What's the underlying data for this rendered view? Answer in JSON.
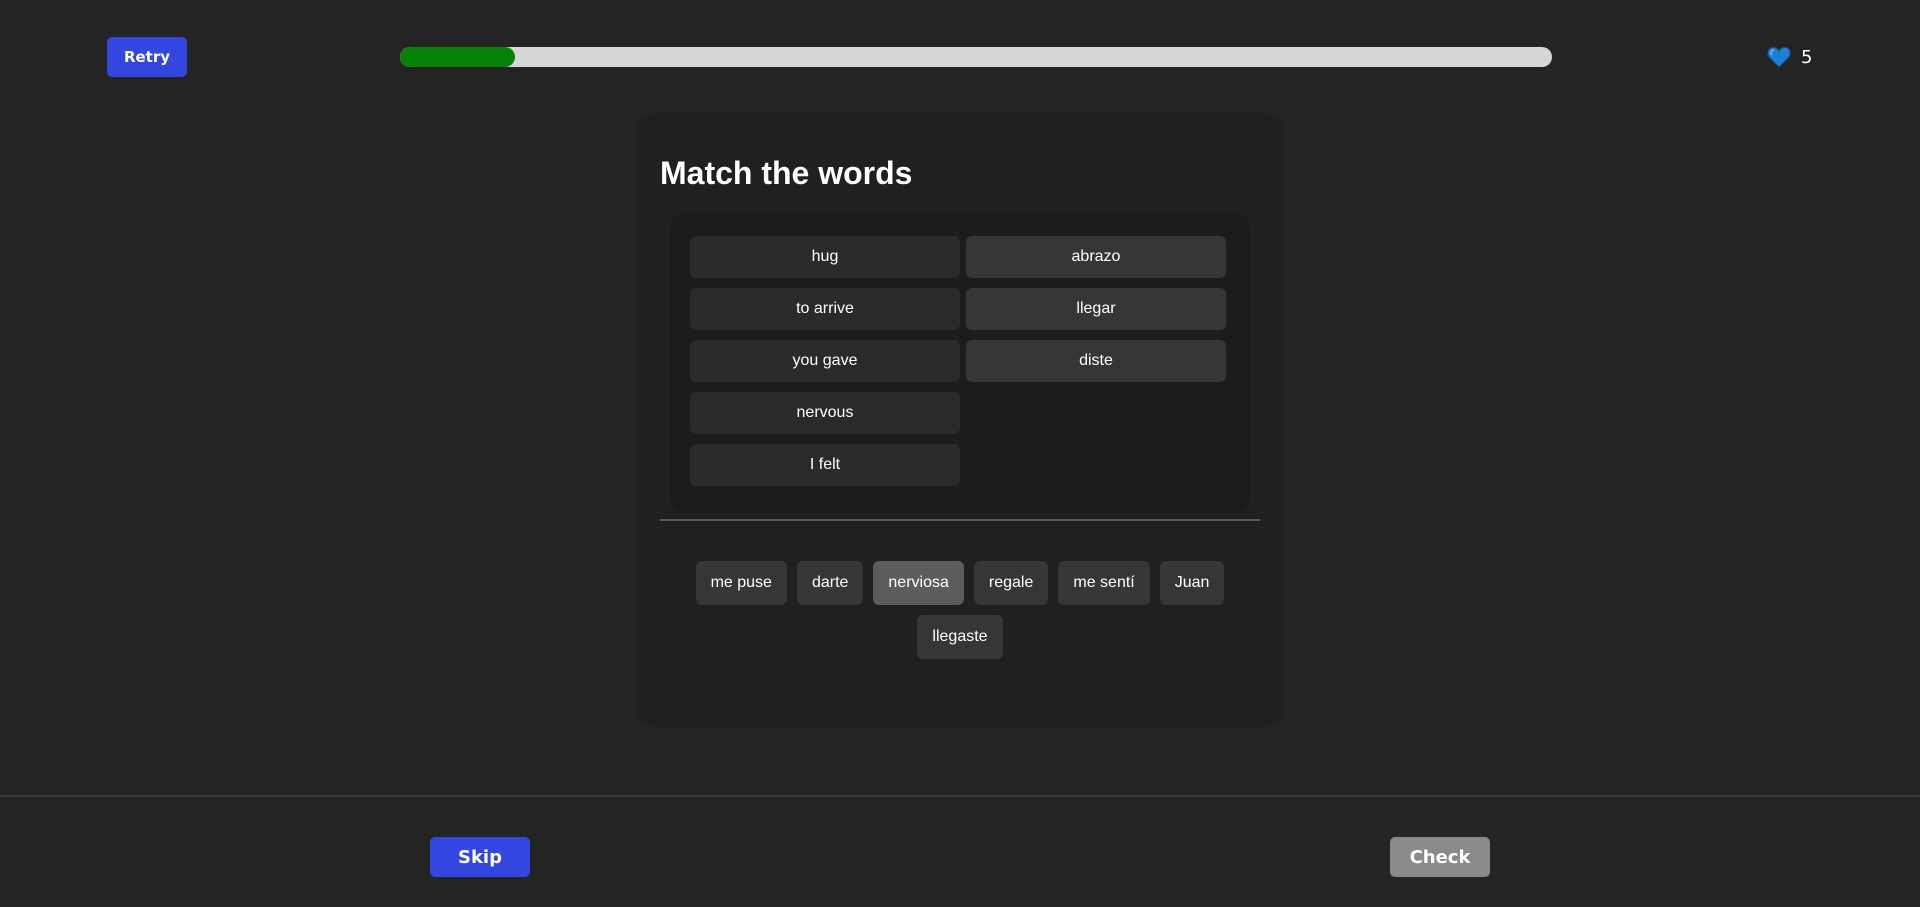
{
  "header": {
    "retry_label": "Retry",
    "progress_fraction": 0.1,
    "hearts_icon": "heart-icon",
    "hearts_count": "5"
  },
  "exercise": {
    "title": "Match the words",
    "pairs": [
      {
        "left": "hug",
        "right": "abrazo"
      },
      {
        "left": "to arrive",
        "right": "llegar"
      },
      {
        "left": "you gave",
        "right": "diste"
      },
      {
        "left": "nervous",
        "right": ""
      },
      {
        "left": "I felt",
        "right": ""
      }
    ],
    "word_bank": [
      "me puse",
      "darte",
      "nerviosa",
      "regale",
      "me sentí",
      "Juan",
      "llegaste"
    ],
    "selected_word": "nerviosa"
  },
  "footer": {
    "skip_label": "Skip",
    "check_label": "Check"
  },
  "colors": {
    "background": "#242424",
    "accent_blue": "#3346e0",
    "progress_green": "#068306",
    "heart_blue": "#1e7fd6",
    "check_disabled": "#8a8a8a"
  }
}
